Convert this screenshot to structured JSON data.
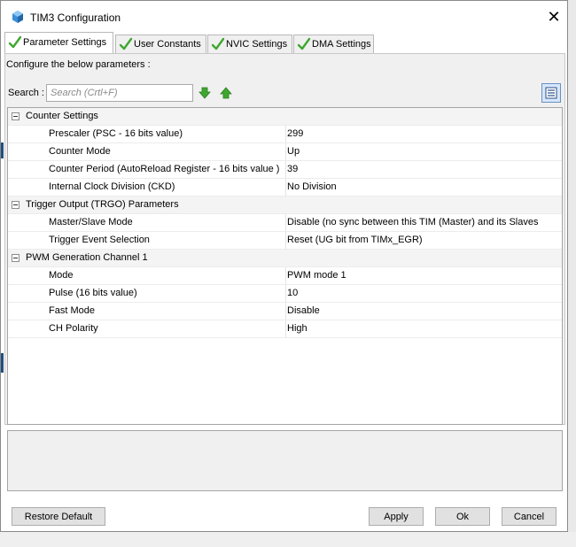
{
  "window": {
    "title": "TIM3 Configuration",
    "close_glyph": "✕"
  },
  "tabs": [
    {
      "label": "Parameter Settings",
      "active": true
    },
    {
      "label": "User Constants",
      "active": false
    },
    {
      "label": "NVIC Settings",
      "active": false
    },
    {
      "label": "DMA Settings",
      "active": false
    }
  ],
  "panel": {
    "configure_label": "Configure the below parameters :"
  },
  "search": {
    "label": "Search :",
    "placeholder": "Search (Crtl+F)"
  },
  "tree": {
    "groups": [
      {
        "label": "Counter Settings",
        "params": [
          {
            "name": "Prescaler (PSC - 16 bits value)",
            "value": "299"
          },
          {
            "name": "Counter Mode",
            "value": "Up"
          },
          {
            "name": "Counter Period (AutoReload Register - 16 bits value )",
            "value": "39"
          },
          {
            "name": "Internal Clock Division (CKD)",
            "value": "No Division"
          }
        ]
      },
      {
        "label": "Trigger Output (TRGO) Parameters",
        "params": [
          {
            "name": "Master/Slave Mode",
            "value": "Disable (no sync between this TIM (Master) and its Slaves"
          },
          {
            "name": "Trigger Event Selection",
            "value": "Reset (UG bit from TIMx_EGR)"
          }
        ]
      },
      {
        "label": "PWM Generation Channel 1",
        "params": [
          {
            "name": "Mode",
            "value": "PWM mode 1"
          },
          {
            "name": "Pulse (16 bits value)",
            "value": "10"
          },
          {
            "name": "Fast Mode",
            "value": "Disable"
          },
          {
            "name": "CH Polarity",
            "value": "High"
          }
        ]
      }
    ]
  },
  "buttons": {
    "restore_default": "Restore Default",
    "apply": "Apply",
    "ok": "Ok",
    "cancel": "Cancel"
  },
  "icons": {
    "app": "cube-icon",
    "tab_status": "checkmark-icon",
    "move_down": "arrow-down-icon",
    "move_up": "arrow-up-icon",
    "view": "list-view-icon"
  },
  "colors": {
    "check_green": "#3fa72f",
    "view_button_bg": "#d6e6fb",
    "app_icon_blue": "#3a8fd8"
  }
}
